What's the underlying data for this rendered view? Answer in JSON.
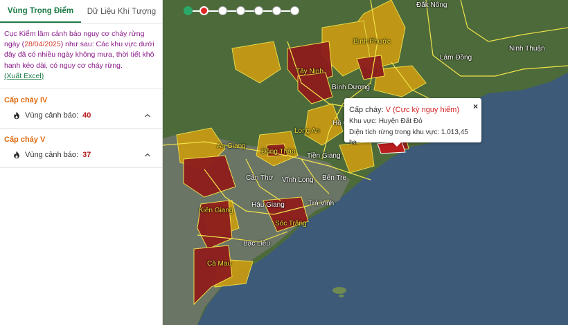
{
  "tabs": [
    {
      "label": "Vùng Trọng Điểm"
    },
    {
      "label": "Dữ Liệu Khí Tượng"
    }
  ],
  "notice": {
    "text_before": "Cục Kiểm lâm cảnh báo nguy cơ cháy rừng ngày (",
    "date": "28/04/2025",
    "text_after": ") như sau: Các khu vực dưới đây đã có nhiều ngày không mưa, thời tiết khô hanh kéo dài, có nguy cơ cháy rừng.",
    "export_label": "(Xuất Excel)"
  },
  "levels": [
    {
      "title": "Cấp cháy IV",
      "label": "Vùng cảnh báo:",
      "count": "40"
    },
    {
      "title": "Cấp cháy V",
      "label": "Vùng cảnh báo:",
      "count": "37"
    }
  ],
  "popup": {
    "title_label": "Cấp cháy:",
    "title_value": "V (Cực kỳ nguy hiểm)",
    "area_line": "Khu vực: Huyện Đất Đỏ",
    "forest_line": "Diện tích rừng trong khu vực: 1.013,45 ha",
    "close": "×"
  },
  "map_labels": {
    "dak_nong": "Đắk Nông",
    "binh_phuoc": "Bình Phước",
    "lam_dong": "Lâm Đồng",
    "ninh_thuan": "Ninh Thuận",
    "tay_ninh": "Tây Ninh",
    "binh_duong": "Bình Dương",
    "ho_chi_minh": "Hồ Ch",
    "long_an": "Long An",
    "an_giang": "An Giang",
    "dong_thap": "Đồng Tháp",
    "tien_giang": "Tiền Giang",
    "can_tho": "Cần Thơ",
    "vinh_long": "Vĩnh Long",
    "ben_tre": "Bến Tre",
    "hau_giang": "Hậu Giang",
    "tra_vinh": "Trà Vinh",
    "kien_giang": "Kiên Giang",
    "soc_trang": "Sóc Trăng",
    "bac_lieu": "Bạc Liêu",
    "ca_mau": "Cà Mau"
  },
  "colors": {
    "accent": "#1a7a45",
    "level_iv_title": "#e06a10",
    "danger": "#d12424",
    "zone_iv": "#c99a12",
    "zone_v": "#8e1d1d",
    "sea": "#3d5b78"
  }
}
